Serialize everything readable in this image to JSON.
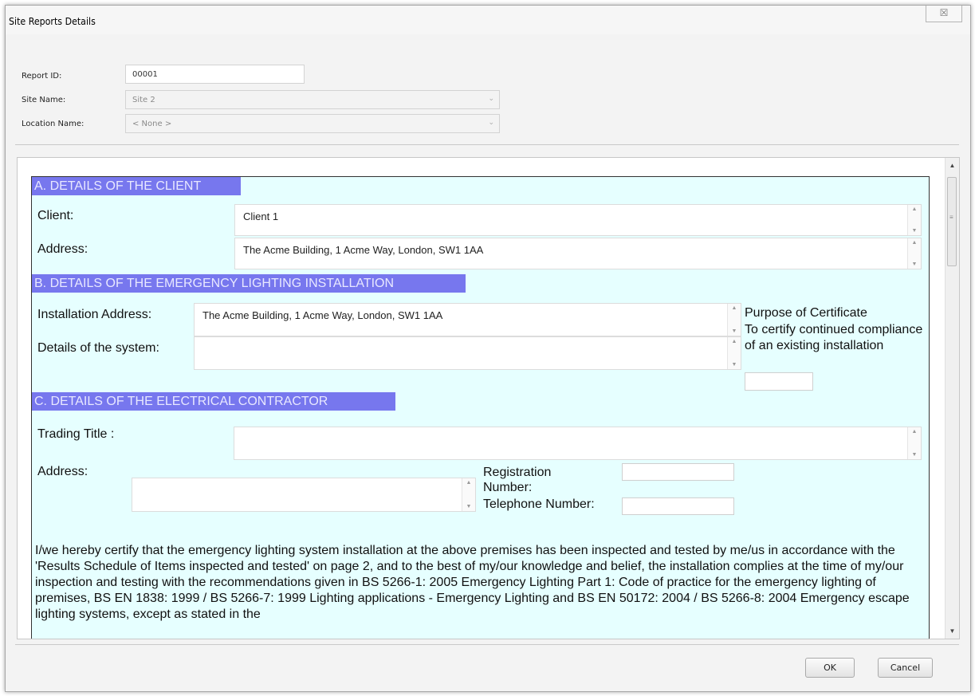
{
  "window": {
    "title": "Site Reports Details",
    "close_glyph": "☒"
  },
  "fields": {
    "report_id": {
      "label": "Report ID:",
      "value": "00001"
    },
    "site_name": {
      "label": "Site Name:",
      "value": "Site 2"
    },
    "location_name": {
      "label": "Location Name:",
      "value": "< None >"
    }
  },
  "form": {
    "section_a": {
      "heading": "A. DETAILS OF THE CLIENT",
      "client_label": "Client:",
      "client_value": "Client 1",
      "address_label": "Address:",
      "address_value": "The Acme Building, 1 Acme Way, London, SW1 1AA"
    },
    "section_b": {
      "heading": "B. DETAILS OF THE EMERGENCY LIGHTING INSTALLATION",
      "install_address_label": "Installation Address:",
      "install_address_value": "The Acme Building, 1 Acme Way, London, SW1 1AA",
      "system_details_label": "Details of the system:",
      "system_details_value": "",
      "purpose_title": "Purpose of Certificate",
      "purpose_text": "To certify continued compliance of an existing installation"
    },
    "section_c": {
      "heading": "C. DETAILS OF THE ELECTRICAL CONTRACTOR",
      "trading_title_label": "Trading Title :",
      "trading_title_value": "",
      "address_label": "Address:",
      "address_value": "",
      "registration_label": "Registration Number:",
      "registration_value": "",
      "telephone_label": "Telephone Number:",
      "telephone_value": ""
    },
    "certification_text": "I/we hereby certify that the emergency lighting system installation at the above premises has been inspected and tested by me/us in accordance with the 'Results Schedule of Items inspected and tested' on page 2, and to the best of my/our knowledge and belief, the installation complies at the time of my/our inspection and testing with the recommendations given in BS 5266-1: 2005 Emergency Lighting Part 1: Code of practice for the emergency lighting of premises, BS EN 1838: 1999 / BS 5266-7: 1999 Lighting applications - Emergency Lighting and BS EN 50172: 2004 / BS 5266-8: 2004 Emergency escape lighting systems, except as stated in the"
  },
  "buttons": {
    "ok": "OK",
    "cancel": "Cancel"
  },
  "colors": {
    "section_heading_bg": "#7777ee",
    "form_bg": "#e6ffff"
  },
  "icons": {
    "scroll_up": "▲",
    "scroll_down": "▼",
    "dropdown": "⌄"
  }
}
